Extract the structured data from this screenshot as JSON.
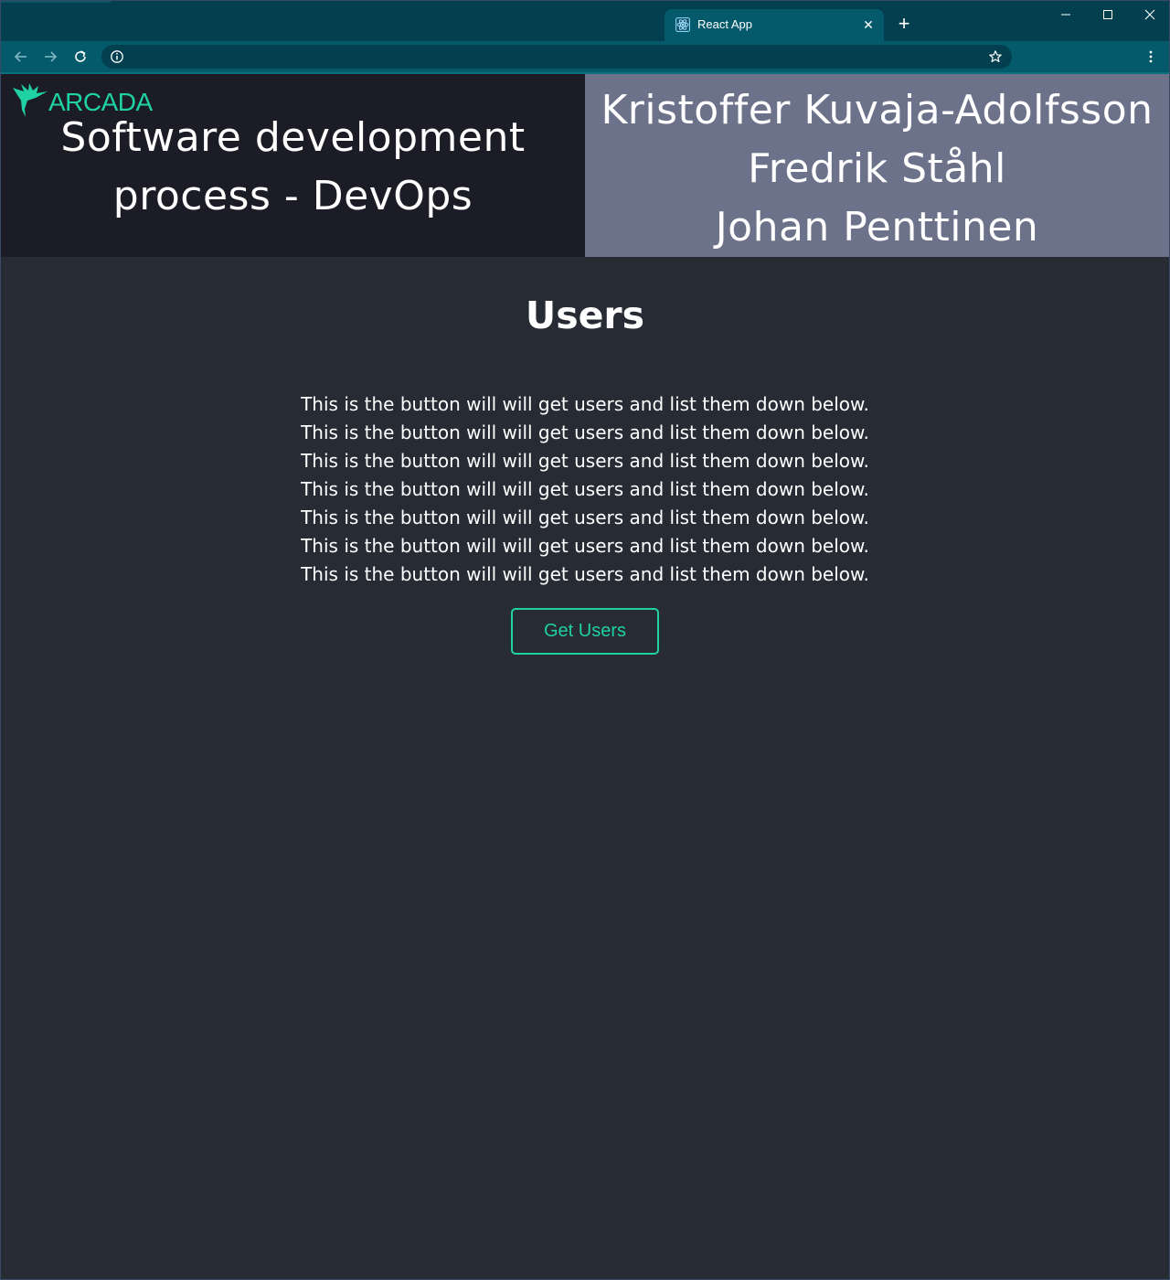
{
  "browser": {
    "tab": {
      "title": "React App",
      "close_label": "✕"
    },
    "new_tab_label": "+",
    "window_controls": {
      "minimize": "—",
      "maximize": "☐",
      "close": "✕"
    },
    "address_bar": {
      "value": ""
    },
    "icons": [
      "back-icon",
      "forward-icon",
      "reload-icon",
      "info-icon",
      "star-icon",
      "menu-icon",
      "react-favicon"
    ]
  },
  "header": {
    "logo_text": "ARCADA",
    "course_title": "Software development\nprocess - DevOps",
    "authors": [
      "Kristoffer Kuvaja-Adolfsson",
      "Fredrik Ståhl",
      "Johan Penttinen"
    ]
  },
  "main": {
    "heading": "Users",
    "description_lines": [
      "This is the button will will get users and list them down below.",
      "This is the button will will get users and list them down below.",
      "This is the button will will get users and list them down below.",
      "This is the button will will get users and list them down below.",
      "This is the button will will get users and list them down below.",
      "This is the button will will get users and list them down below.",
      "This is the button will will get users and list them down below."
    ],
    "button_label": "Get Users"
  },
  "colors": {
    "page_background": "#272b34",
    "header_left_background": "#1c1c26",
    "header_right_background": "#6b7289",
    "accent": "#1fd1a4",
    "browser_frame": "#023f4f",
    "browser_toolbar": "#045a6b"
  }
}
